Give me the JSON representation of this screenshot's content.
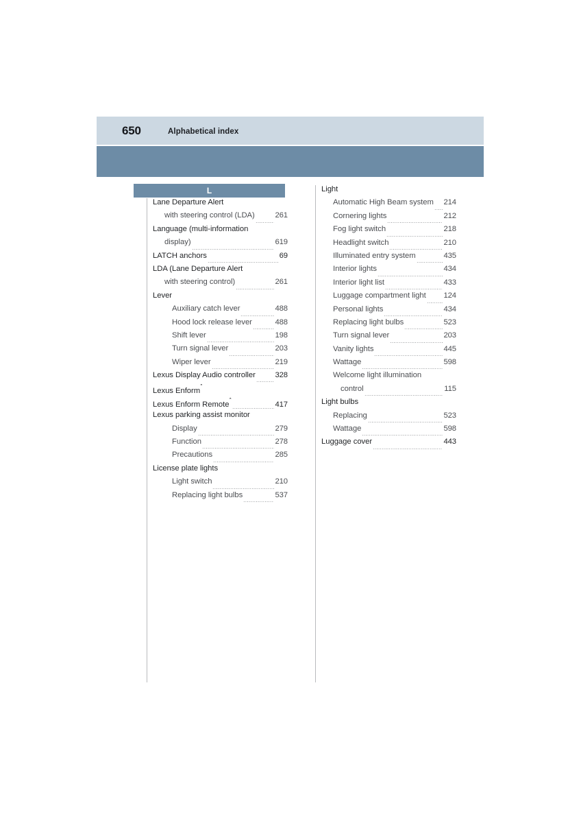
{
  "header": {
    "page_number": "650",
    "title": "Alphabetical index",
    "bar_light_color": "#ccd8e2",
    "bar_dark_color": "#6d8ca6"
  },
  "section": {
    "letter": "L",
    "letter_bar_color": "#6d8ca6"
  },
  "columns": [
    {
      "name": "left-column",
      "entries": [
        {
          "level": 0,
          "label": "Lane Departure Alert",
          "page": "",
          "leader": false
        },
        {
          "level": 1,
          "label": "with steering control (LDA)",
          "page": "261",
          "leader": true
        },
        {
          "level": 0,
          "label": "Language (multi-information",
          "page": "",
          "leader": false
        },
        {
          "level": 1,
          "label": "display)",
          "page": "619",
          "leader": true
        },
        {
          "level": 0,
          "label": "LATCH anchors",
          "page": "69",
          "leader": true
        },
        {
          "level": 0,
          "label": "LDA (Lane Departure Alert",
          "page": "",
          "leader": false
        },
        {
          "level": 1,
          "label": "with steering control)",
          "page": "261",
          "leader": true
        },
        {
          "level": 0,
          "label": "Lever",
          "page": "",
          "leader": false
        },
        {
          "level": 2,
          "label": "Auxiliary catch lever",
          "page": "488",
          "leader": true
        },
        {
          "level": 2,
          "label": "Hood lock release lever",
          "page": "488",
          "leader": true
        },
        {
          "level": 2,
          "label": "Shift lever",
          "page": "198",
          "leader": true
        },
        {
          "level": 2,
          "label": "Turn signal lever",
          "page": "203",
          "leader": true
        },
        {
          "level": 2,
          "label": "Wiper lever",
          "page": "219",
          "leader": true
        },
        {
          "level": 0,
          "label": "Lexus Display Audio controller",
          "page": "328",
          "leader": true
        },
        {
          "level": 0,
          "label": "Lexus Enform",
          "page": "",
          "leader": false,
          "superscript": "*"
        },
        {
          "level": 0,
          "label": "Lexus Enform Remote",
          "page": "417",
          "leader": true,
          "superscript": "*"
        },
        {
          "level": 0,
          "label": "Lexus parking assist monitor",
          "page": "",
          "leader": false
        },
        {
          "level": 2,
          "label": "Display",
          "page": "279",
          "leader": true
        },
        {
          "level": 2,
          "label": "Function",
          "page": "278",
          "leader": true
        },
        {
          "level": 2,
          "label": "Precautions",
          "page": "285",
          "leader": true
        },
        {
          "level": 0,
          "label": "License plate lights",
          "page": "",
          "leader": false
        },
        {
          "level": 2,
          "label": "Light switch",
          "page": "210",
          "leader": true
        },
        {
          "level": 2,
          "label": "Replacing light bulbs",
          "page": "537",
          "leader": true
        }
      ]
    },
    {
      "name": "right-column",
      "entries": [
        {
          "level": 0,
          "label": "Light",
          "page": "",
          "leader": false
        },
        {
          "level": 1,
          "label": "Automatic High Beam system",
          "page": "214",
          "leader": true
        },
        {
          "level": 1,
          "label": "Cornering lights",
          "page": "212",
          "leader": true
        },
        {
          "level": 1,
          "label": "Fog light switch",
          "page": "218",
          "leader": true
        },
        {
          "level": 1,
          "label": "Headlight switch",
          "page": "210",
          "leader": true
        },
        {
          "level": 1,
          "label": "Illuminated entry system",
          "page": "435",
          "leader": true
        },
        {
          "level": 1,
          "label": "Interior lights",
          "page": "434",
          "leader": true
        },
        {
          "level": 1,
          "label": "Interior light list",
          "page": "433",
          "leader": true
        },
        {
          "level": 1,
          "label": "Luggage compartment light",
          "page": "124",
          "leader": true
        },
        {
          "level": 1,
          "label": "Personal lights",
          "page": "434",
          "leader": true
        },
        {
          "level": 1,
          "label": "Replacing light bulbs",
          "page": "523",
          "leader": true
        },
        {
          "level": 1,
          "label": "Turn signal lever",
          "page": "203",
          "leader": true
        },
        {
          "level": 1,
          "label": "Vanity lights",
          "page": "445",
          "leader": true
        },
        {
          "level": 1,
          "label": "Wattage",
          "page": "598",
          "leader": true
        },
        {
          "level": 1,
          "label": "Welcome light illumination",
          "page": "",
          "leader": false
        },
        {
          "level": 2,
          "label": "control",
          "page": "115",
          "leader": true
        },
        {
          "level": 0,
          "label": "Light bulbs",
          "page": "",
          "leader": false
        },
        {
          "level": 1,
          "label": "Replacing",
          "page": "523",
          "leader": true
        },
        {
          "level": 1,
          "label": "Wattage",
          "page": "598",
          "leader": true
        },
        {
          "level": 0,
          "label": "Luggage cover",
          "page": "443",
          "leader": true
        }
      ]
    }
  ]
}
